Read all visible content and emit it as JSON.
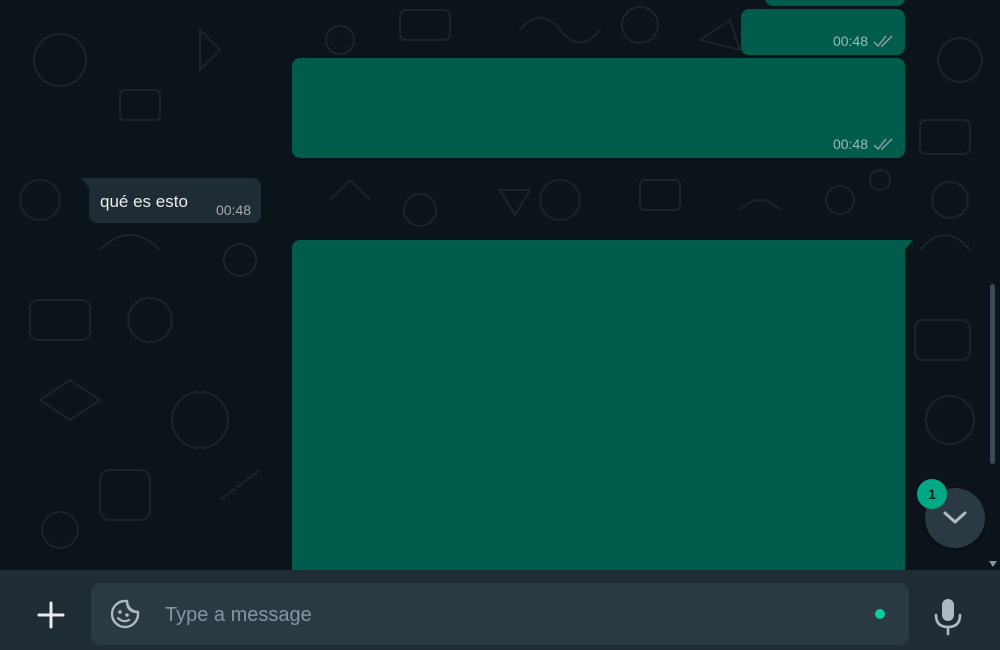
{
  "messages": [
    {
      "direction": "outgoing",
      "kind": "text",
      "time": "00:48",
      "status_icon": "double-check-icon"
    },
    {
      "direction": "outgoing",
      "kind": "media",
      "time": "00:48",
      "status_icon": "double-check-icon"
    },
    {
      "direction": "incoming",
      "kind": "text",
      "text": "qué es esto",
      "time": "00:48"
    },
    {
      "direction": "outgoing",
      "kind": "media"
    }
  ],
  "scroll_down": {
    "unread_count": "1",
    "icon": "chevron-down-icon"
  },
  "composer": {
    "placeholder": "Type a message",
    "value": "",
    "attach_icon": "plus-icon",
    "sticker_icon": "sticker-icon",
    "mic_icon": "mic-icon"
  },
  "colors": {
    "chat_background": "#0b141a",
    "outgoing_bubble": "#005c4b",
    "incoming_bubble": "#202c33",
    "composer_bar": "#202c33",
    "input_box": "#2a3942",
    "accent": "#00a884"
  }
}
